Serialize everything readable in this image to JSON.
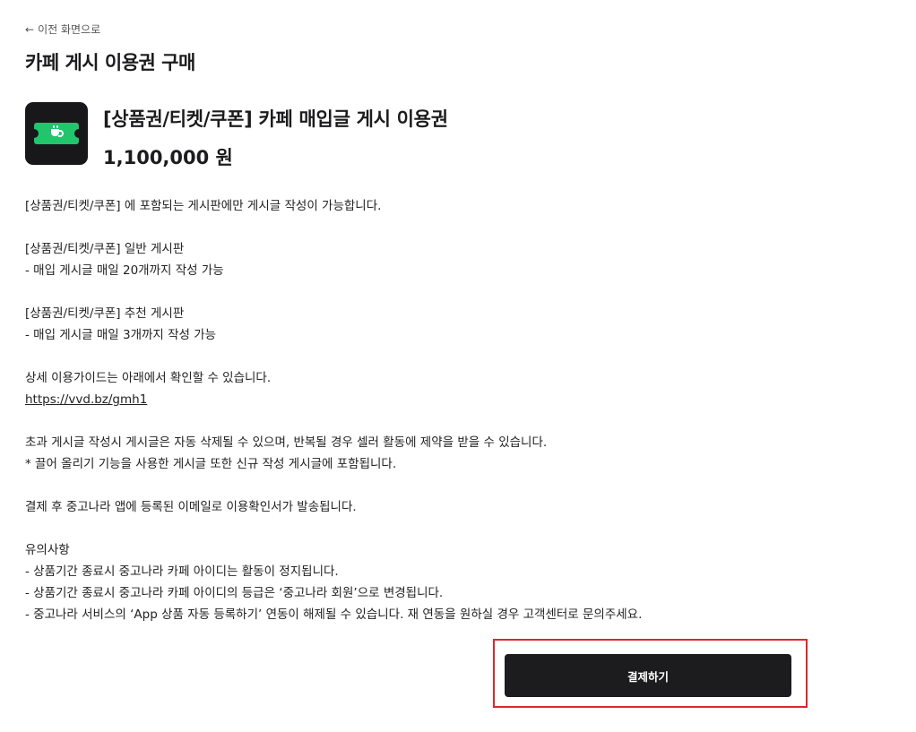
{
  "header": {
    "back_arrow": "←",
    "back_label": "이전 화면으로",
    "title": "카페 게시 이용권 구매"
  },
  "product": {
    "icon": "coffee-ticket-icon",
    "icon_colors": {
      "background": "#18181a",
      "ticket": "#21c56b"
    },
    "name": "[상품권/티켓/쿠폰] 카페 매입글 게시 이용권",
    "price": "1,100,000 원"
  },
  "description": {
    "lines": [
      "[상품권/티켓/쿠폰] 에 포함되는 게시판에만 게시글 작성이 가능합니다.",
      "",
      "[상품권/티켓/쿠폰] 일반 게시판",
      "- 매입 게시글 매일 20개까지 작성 가능",
      "",
      "[상품권/티켓/쿠폰] 추천 게시판",
      "- 매입 게시글 매일 3개까지 작성 가능",
      "",
      "상세 이용가이드는 아래에서 확인할 수 있습니다.",
      "https://vvd.bz/gmh1",
      "",
      "초과 게시글 작성시 게시글은 자동 삭제될 수 있으며, 반복될 경우 셀러 활동에 제약을 받을 수 있습니다.",
      "* 끌어 올리기 기능을 사용한 게시글 또한 신규 작성 게시글에 포함됩니다.",
      "",
      "결제 후 중고나라 앱에 등록된 이메일로 이용확인서가 발송됩니다.",
      "",
      "유의사항",
      "- 상품기간 종료시 중고나라 카페 아이디는 활동이 정지됩니다.",
      "- 상품기간 종료시 중고나라 카페 아이디의 등급은 ‘중고나라 회원’으로 변경됩니다.",
      "- 중고나라 서비스의 ‘App 상품 자동 등록하기’ 연동이 해제될 수 있습니다. 재 연동을 원하실 경우 고객센터로 문의주세요."
    ]
  },
  "actions": {
    "pay_label": "결제하기",
    "highlight_color": "#e0262b",
    "button_color": "#1c1c1e"
  }
}
